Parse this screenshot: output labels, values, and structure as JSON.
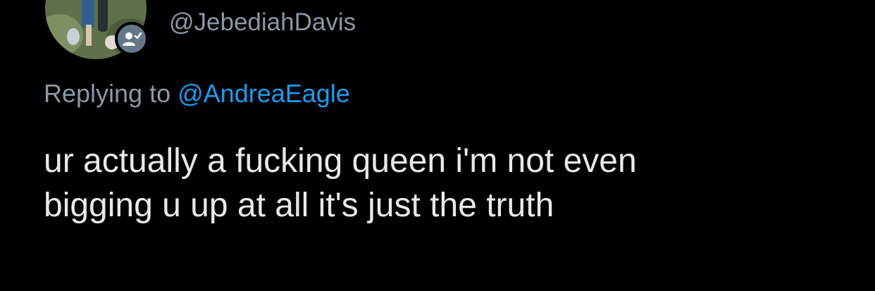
{
  "user": {
    "handle": "@JebediahDavis",
    "avatar_icon": "profile-photo",
    "badge_icon": "follows-you-icon"
  },
  "reply": {
    "prefix": "Replying to",
    "target": "@AndreaEagle"
  },
  "tweet": {
    "lines": [
      "ur actually a fucking queen i'm not even",
      "bigging u up at all it's just the truth"
    ]
  },
  "colors": {
    "background": "#000000",
    "text": "#e7e9ea",
    "muted": "#8b98a5",
    "link": "#1d9bf0",
    "badge": "#657786"
  }
}
